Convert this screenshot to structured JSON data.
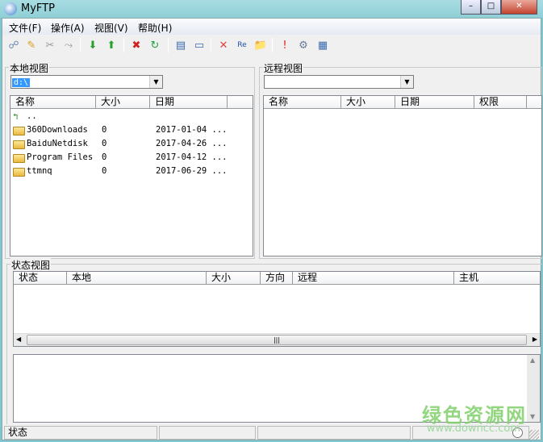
{
  "window": {
    "title": "MyFTP",
    "buttons": [
      "–",
      "□",
      "✕"
    ]
  },
  "menu": [
    "文件(F)",
    "操作(A)",
    "视图(V)",
    "帮助(H)"
  ],
  "toolbar": [
    {
      "icon": "connect-icon",
      "glyph": "☍",
      "color": "#6a8ab0"
    },
    {
      "icon": "quick-connect-icon",
      "glyph": "✎",
      "color": "#d9a020"
    },
    {
      "icon": "disconnect-icon",
      "glyph": "✂",
      "color": "#999"
    },
    {
      "icon": "reconnect-icon",
      "glyph": "⤳",
      "color": "#999"
    },
    {
      "icon": "download-icon",
      "glyph": "⬇",
      "color": "#2aa02a"
    },
    {
      "icon": "upload-icon",
      "glyph": "⬆",
      "color": "#2aa02a"
    },
    {
      "icon": "stop-icon",
      "glyph": "✖",
      "color": "#d02020"
    },
    {
      "icon": "refresh-icon",
      "glyph": "↻",
      "color": "#20a040"
    },
    {
      "icon": "view-list-icon",
      "glyph": "▤",
      "color": "#3a6ab0"
    },
    {
      "icon": "view-detail-icon",
      "glyph": "▭",
      "color": "#3a6ab0"
    },
    {
      "icon": "delete-icon",
      "glyph": "✕",
      "color": "#e04040"
    },
    {
      "icon": "rename-icon",
      "glyph": "Re",
      "color": "#2050b0"
    },
    {
      "icon": "new-folder-icon",
      "glyph": "📁",
      "color": "#e0b030"
    },
    {
      "icon": "alert-icon",
      "glyph": "!",
      "color": "#e02020"
    },
    {
      "icon": "options-icon",
      "glyph": "⚙",
      "color": "#6a7a9a"
    },
    {
      "icon": "window-icon",
      "glyph": "▦",
      "color": "#3a6ab0"
    }
  ],
  "local": {
    "label": "本地视图",
    "path": "d:\\",
    "columns": [
      "名称",
      "大小",
      "日期",
      ""
    ],
    "rows": [
      {
        "name": "..",
        "size": "",
        "date": "",
        "type": "up"
      },
      {
        "name": "360Downloads",
        "size": "0",
        "date": "2017-01-04 ...",
        "type": "folder"
      },
      {
        "name": "BaiduNetdisk",
        "size": "0",
        "date": "2017-04-26 ...",
        "type": "folder"
      },
      {
        "name": "Program Files",
        "size": "0",
        "date": "2017-04-12 ...",
        "type": "folder"
      },
      {
        "name": "ttmnq",
        "size": "0",
        "date": "2017-06-29 ...",
        "type": "folder"
      }
    ]
  },
  "remote": {
    "label": "远程视图",
    "path": "",
    "columns": [
      "名称",
      "大小",
      "日期",
      "权限"
    ]
  },
  "status_view": {
    "label": "状态视图",
    "columns": [
      "状态",
      "本地",
      "大小",
      "方向",
      "远程",
      "主机"
    ],
    "scroll_thumb": "|||"
  },
  "statusbar": {
    "text": "状态"
  },
  "watermark": {
    "line1": "绿色资源网",
    "line2": "www.downcc.com"
  }
}
